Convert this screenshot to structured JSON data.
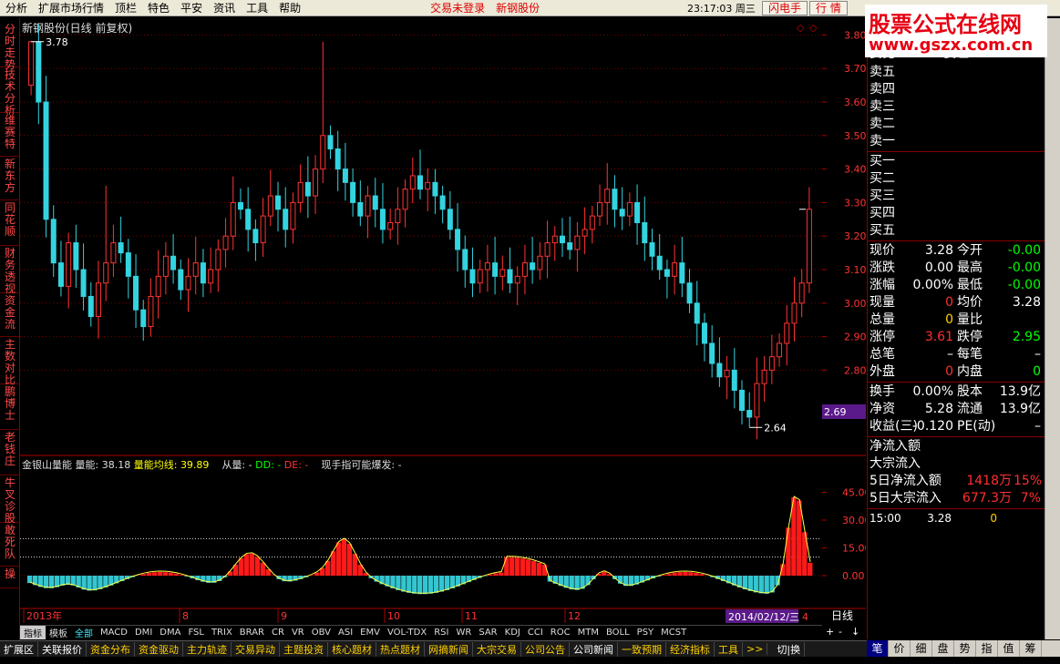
{
  "menu": {
    "items": [
      "分析",
      "扩展市场行情",
      "顶栏",
      "特色",
      "平安",
      "资讯",
      "工具",
      "帮助"
    ],
    "alert1": "交易未登录",
    "alert2": "新钢股份",
    "time": "23:17:03 周三",
    "btn_flash": "闪电手",
    "btn_quote": "行  情"
  },
  "logo": {
    "line1": "股票公式在线网",
    "line2": "www.gszx.com.cn"
  },
  "left_tabs": [
    "分时走势",
    "技术分析",
    "维赛特",
    "新东方",
    "同花顺",
    "财务透视",
    "资金流",
    "主数对比",
    "鹏博士",
    "老钱庄",
    "牛叉诊股",
    "敢死队",
    "操"
  ],
  "chart": {
    "title": "新钢股份(日线 前复权)",
    "high_label": "3.78",
    "low_label": "2.64",
    "cursor_price": "2.69",
    "period": "日线",
    "date_box": "2014/02/12/三",
    "last_month_label": "4",
    "month_labels": [
      "2013年",
      "8",
      "9",
      "10",
      "11",
      "12"
    ]
  },
  "price_axis": {
    "ticks": [
      "3.80",
      "3.70",
      "3.60",
      "3.50",
      "3.40",
      "3.30",
      "3.20",
      "3.10",
      "3.00",
      "2.90",
      "2.80"
    ]
  },
  "vol_axis": {
    "ticks": [
      "45.00",
      "30.00",
      "15.00",
      "0.00"
    ]
  },
  "volume_legend": {
    "name": "金银山量能",
    "v1_label": "量能:",
    "v1": "38.18",
    "v2_label": "量能均线:",
    "v2": "39.89",
    "v3_label": "从量:",
    "v3": "-",
    "v4_label": "DD:",
    "v4": "-",
    "v5_label": "DE:",
    "v5": "-",
    "v6_label": "现手指可能爆发:",
    "v6": "-"
  },
  "indicator_tabs": [
    "指标",
    "模板",
    "全部",
    "MACD",
    "DMI",
    "DMA",
    "FSL",
    "TRIX",
    "BRAR",
    "CR",
    "VR",
    "OBV",
    "ASI",
    "EMV",
    "VOL-TDX",
    "RSI",
    "WR",
    "SAR",
    "KDJ",
    "CCI",
    "ROC",
    "MTM",
    "BOLL",
    "PSY",
    "MCST"
  ],
  "indicator_ctrl": [
    "+",
    "-",
    "↓"
  ],
  "status_tabs": [
    "扩展区",
    "关联报价",
    "资金分布",
    "资金驱动",
    "主力轨迹",
    "交易异动",
    "主题投资",
    "核心题材",
    "热点题材",
    "网摘新闻",
    "大宗交易",
    "公司公告",
    "公司新闻",
    "一致预期",
    "经济指标",
    "工具",
    ">>",
    "切|换"
  ],
  "right_tabs": [
    "笔",
    "价",
    "细",
    "盘",
    "势",
    "指",
    "值",
    "筹"
  ],
  "quote": {
    "top_partial": "委比    0.00% 委差",
    "sell": [
      "卖五",
      "卖四",
      "卖三",
      "卖二",
      "卖一"
    ],
    "buy": [
      "买一",
      "买二",
      "买三",
      "买四",
      "买五"
    ],
    "rows": [
      {
        "l1": "现价",
        "v1": "3.28",
        "c1": "#fff",
        "l2": "今开",
        "v2": "-0.00",
        "c2": "#0f0"
      },
      {
        "l1": "涨跌",
        "v1": "0.00",
        "c1": "#fff",
        "l2": "最高",
        "v2": "-0.00",
        "c2": "#0f0"
      },
      {
        "l1": "涨幅",
        "v1": "0.00%",
        "c1": "#fff",
        "l2": "最低",
        "v2": "-0.00",
        "c2": "#0f0"
      },
      {
        "l1": "现量",
        "v1": "0",
        "c1": "#ff3030",
        "l2": "均价",
        "v2": "3.28",
        "c2": "#fff"
      },
      {
        "l1": "总量",
        "v1": "0",
        "c1": "#ffd000",
        "l2": "量比",
        "v2": "",
        "c2": "#fff"
      },
      {
        "l1": "涨停",
        "v1": "3.61",
        "c1": "#ff3030",
        "l2": "跌停",
        "v2": "2.95",
        "c2": "#0f0"
      },
      {
        "l1": "总笔",
        "v1": "–",
        "c1": "#fff",
        "l2": "每笔",
        "v2": "–",
        "c2": "#fff"
      },
      {
        "l1": "外盘",
        "v1": "0",
        "c1": "#ff3030",
        "l2": "内盘",
        "v2": "0",
        "c2": "#0f0"
      }
    ],
    "rows2": [
      {
        "l1": "换手",
        "v1": "0.00%",
        "c1": "#fff",
        "l2": "股本",
        "v2": "13.9亿",
        "c2": "#fff"
      },
      {
        "l1": "净资",
        "v1": "5.28",
        "c1": "#fff",
        "l2": "流通",
        "v2": "13.9亿",
        "c2": "#fff"
      },
      {
        "l1": "收益(三)",
        "v1": "-0.120",
        "c1": "#fff",
        "l2": "PE(动)",
        "v2": "–",
        "c2": "#fff"
      }
    ],
    "flow_title1": "净流入额",
    "flow_title2": "大宗流入",
    "flow": [
      {
        "l": "5日净流入额",
        "v": "1418万",
        "p": "15%"
      },
      {
        "l": "5日大宗流入",
        "v": "677.3万",
        "p": "7%"
      }
    ],
    "tick": {
      "time": "15:00",
      "price": "3.28",
      "vol": "0"
    }
  },
  "chart_data": {
    "type": "candlestick+bar",
    "ylim": [
      2.6,
      3.85
    ],
    "vol_ylim": [
      0,
      60
    ]
  }
}
